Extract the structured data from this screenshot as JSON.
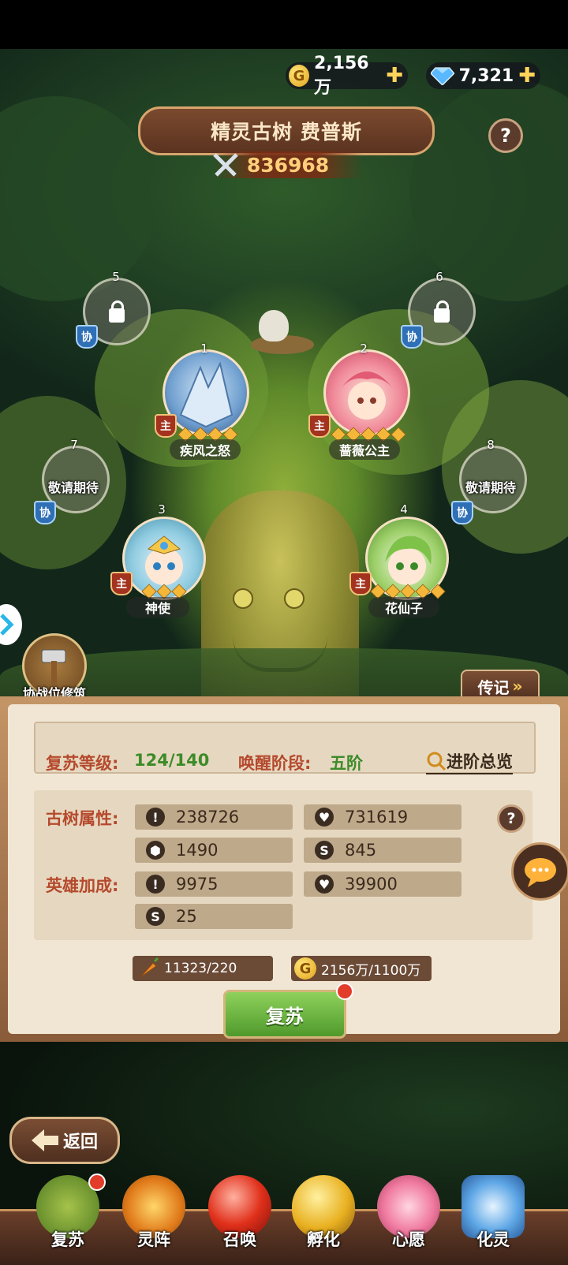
{
  "currencies": {
    "gold": "2,156万",
    "diamond": "7,321"
  },
  "title": "精灵古树 费普斯",
  "power": "836968",
  "slots": [
    {
      "num": "5",
      "tag": "协"
    },
    {
      "num": "6",
      "tag": "协"
    },
    {
      "num": "7",
      "tag": "协",
      "label": "敬请期待"
    },
    {
      "num": "8",
      "tag": "协",
      "label": "敬请期待"
    }
  ],
  "heroes": [
    {
      "num": "1",
      "tag": "主",
      "name": "疾风之怒",
      "stars": 4
    },
    {
      "num": "2",
      "tag": "主",
      "name": "蔷薇公主",
      "stars": 5
    },
    {
      "num": "3",
      "tag": "主",
      "name": "神使",
      "stars": 3
    },
    {
      "num": "4",
      "tag": "主",
      "name": "花仙子",
      "stars": 5
    }
  ],
  "side_button": "协战位修筑",
  "biography": "传记",
  "panel": {
    "revive_level_label": "复苏等级:",
    "revive_level_value": "124/140",
    "awaken_label": "唤醒阶段:",
    "awaken_value": "五阶",
    "overview": "进阶总览",
    "tree_attr_label": "古树属性:",
    "hero_bonus_label": "英雄加成:",
    "tree_stats": [
      "238726",
      "731619",
      "1490",
      "845"
    ],
    "hero_stats": [
      "9975",
      "39900",
      "25"
    ],
    "cost_item": "11323/220",
    "cost_gold": "2156万/1100万",
    "revive_button": "复苏"
  },
  "back_button": "返回",
  "nav": [
    "复苏",
    "灵阵",
    "召唤",
    "孵化",
    "心愿",
    "化灵"
  ],
  "colors": {
    "accent_red": "#b5492d",
    "green": "#3d8b29",
    "panel": "#f1e6d4"
  }
}
